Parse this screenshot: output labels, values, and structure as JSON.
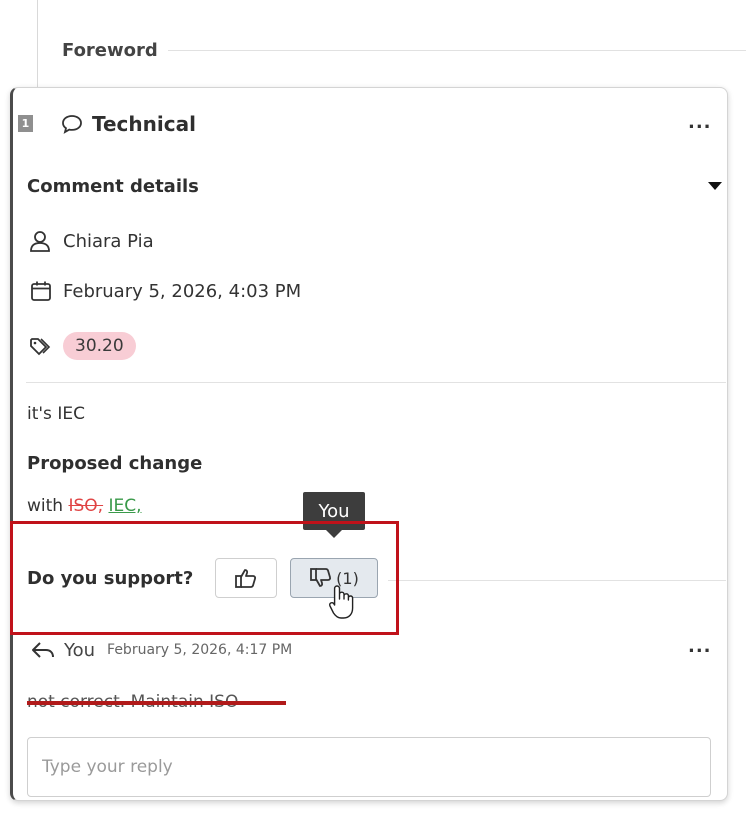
{
  "section": {
    "title": "Foreword"
  },
  "comment": {
    "number": "1",
    "type": "Technical",
    "more_label": "...",
    "details_title": "Comment details",
    "author": "Chiara Pia",
    "date": "February 5, 2026, 4:03 PM",
    "tag": "30.20",
    "text": "it's IEC",
    "proposed_change_label": "Proposed change",
    "proposed_change": {
      "prefix": "with ",
      "deleted": "ISO,",
      "inserted": "IEC,"
    },
    "support_label": "Do you support?",
    "dislike_count": "(1)",
    "tooltip": "You"
  },
  "reply": {
    "author": "You",
    "timestamp": "February 5, 2026, 4:17 PM",
    "more_label": "...",
    "text": "not correct. Maintain ISO"
  },
  "reply_input": {
    "placeholder": "Type your reply"
  },
  "colors": {
    "tag_bg": "#f8cdd5",
    "deleted": "#e04444",
    "inserted": "#3a9a4a",
    "highlight": "#c0121a",
    "tooltip_bg": "#3d3d3d"
  }
}
